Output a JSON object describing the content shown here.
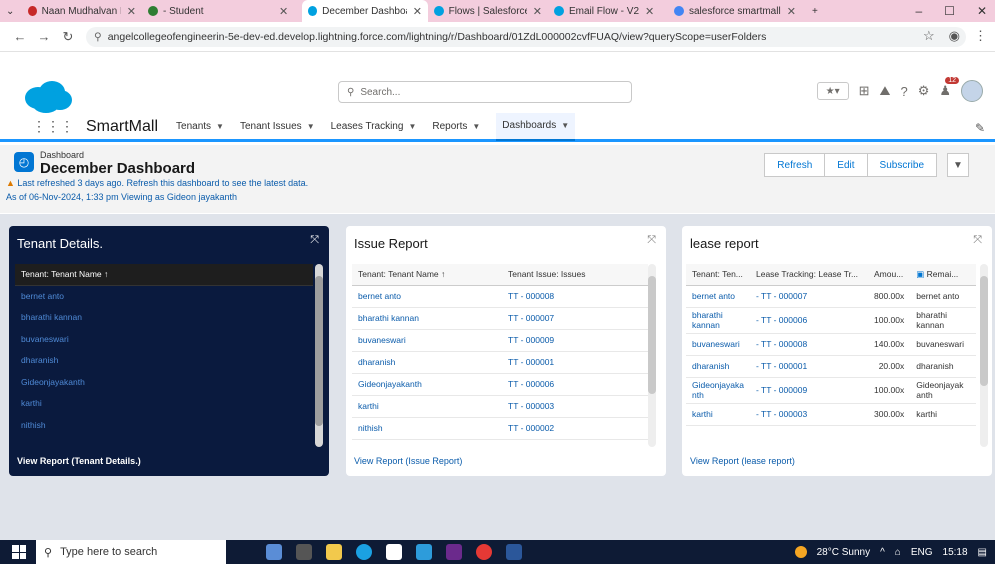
{
  "browser": {
    "tabs": [
      {
        "label": "Naan Mudhalvan Ma",
        "color": "#c62828"
      },
      {
        "label": "- Student",
        "color": "#2e7d32"
      },
      {
        "label": "December Dashboar",
        "color": "#00a1e0",
        "active": true
      },
      {
        "label": "Flows | Salesforce",
        "color": "#00a1e0"
      },
      {
        "label": "Email Flow - V2",
        "color": "#00a1e0"
      },
      {
        "label": "salesforce smartmall",
        "color": "#4285f4"
      }
    ],
    "new_tab": "+",
    "url": "angelcollegeofengineerin-5e-dev-ed.develop.lightning.force.com/lightning/r/Dashboard/01ZdL000002cvfFUAQ/view?queryScope=userFolders",
    "window_controls": {
      "minimize": "–",
      "maximize": "☐",
      "close": "✕"
    }
  },
  "sf": {
    "search_placeholder": "Search...",
    "app_name": "SmartMall",
    "nav": [
      {
        "label": "Tenants"
      },
      {
        "label": "Tenant Issues"
      },
      {
        "label": "Leases Tracking"
      },
      {
        "label": "Reports"
      },
      {
        "label": "Dashboards",
        "active": true
      }
    ],
    "notif_count": "12"
  },
  "dashboard": {
    "label": "Dashboard",
    "title": "December Dashboard",
    "warning": "Last refreshed 3 days ago. Refresh this dashboard to see the latest data.",
    "as_of": "As of 06-Nov-2024, 1:33 pm Viewing as Gideon jayakanth",
    "buttons": {
      "refresh": "Refresh",
      "edit": "Edit",
      "subscribe": "Subscribe"
    }
  },
  "cards": {
    "tenant_details": {
      "title": "Tenant Details.",
      "header": "Tenant: Tenant Name ↑",
      "rows": [
        "bernet anto",
        "bharathi kannan",
        "buvaneswari",
        "dharanish",
        "Gideonjayakanth",
        "karthi",
        "nithish"
      ],
      "footer": "View Report (Tenant Details.)"
    },
    "issue_report": {
      "title": "Issue Report",
      "headers": [
        "Tenant: Tenant Name ↑",
        "Tenant Issue: Issues"
      ],
      "rows": [
        [
          "bernet anto",
          "TT - 000008"
        ],
        [
          "bharathi kannan",
          "TT - 000007"
        ],
        [
          "buvaneswari",
          "TT - 000009"
        ],
        [
          "dharanish",
          "TT - 000001"
        ],
        [
          "Gideonjayakanth",
          "TT - 000006"
        ],
        [
          "karthi",
          "TT - 000003"
        ],
        [
          "nithish",
          "TT - 000002"
        ]
      ],
      "footer": "View Report (Issue Report)"
    },
    "lease_report": {
      "title": "lease report",
      "headers": [
        "Tenant: Ten...",
        "Lease Tracking: Lease Tr...",
        "Amou...",
        "Remai..."
      ],
      "rows": [
        [
          "bernet anto",
          "- TT - 000007",
          "800.00x",
          "bernet anto"
        ],
        [
          "bharathi kannan",
          "- TT - 000006",
          "100.00x",
          "bharathi kannan"
        ],
        [
          "buvaneswari",
          "- TT - 000008",
          "140.00x",
          "buvaneswari"
        ],
        [
          "dharanish",
          "- TT - 000001",
          "20.00x",
          "dharanish"
        ],
        [
          "Gideonjayaka nth",
          "- TT - 000009",
          "100.00x",
          "Gideonjayak anth"
        ],
        [
          "karthi",
          "- TT - 000003",
          "300.00x",
          "karthi"
        ]
      ],
      "footer": "View Report (lease report)"
    }
  },
  "taskbar": {
    "search_placeholder": "Type here to search",
    "weather": "28°C Sunny",
    "lang": "ENG",
    "time": "15:18"
  }
}
